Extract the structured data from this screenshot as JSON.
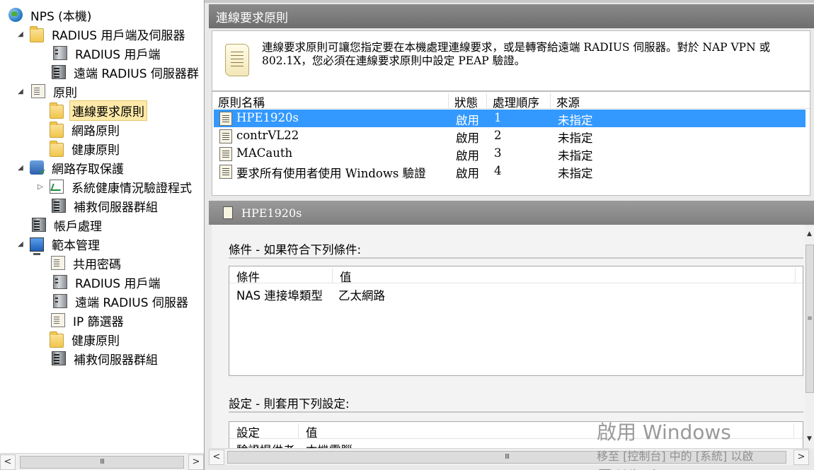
{
  "tree": {
    "items": [
      {
        "label": "NPS (本機)",
        "icon": "globe-icon",
        "level": 0,
        "expander": ""
      },
      {
        "label": "RADIUS 用戶端及伺服器",
        "icon": "folder-icon",
        "level": 1,
        "expander": "◢"
      },
      {
        "label": "RADIUS 用戶端",
        "icon": "server-icon",
        "level": 2,
        "expander": ""
      },
      {
        "label": "遠端 RADIUS 伺服器群",
        "icon": "server-group-icon",
        "level": 2,
        "expander": ""
      },
      {
        "label": "原則",
        "icon": "policy-doc-icon",
        "level": 1,
        "expander": "◢"
      },
      {
        "label": "連線要求原則",
        "icon": "folder-open-icon",
        "level": 2,
        "expander": "",
        "selected": true
      },
      {
        "label": "網路原則",
        "icon": "folder-icon",
        "level": 2,
        "expander": ""
      },
      {
        "label": "健康原則",
        "icon": "folder-icon",
        "level": 2,
        "expander": ""
      },
      {
        "label": "網路存取保護",
        "icon": "shield-icon",
        "level": 1,
        "expander": "◢"
      },
      {
        "label": "系統健康情況驗證程式",
        "icon": "chart-icon",
        "level": 2,
        "expander": "▷"
      },
      {
        "label": "補救伺服器群組",
        "icon": "server-group-icon",
        "level": 2,
        "expander": ""
      },
      {
        "label": "帳戶處理",
        "icon": "accounting-icon",
        "level": 1,
        "expander": ""
      },
      {
        "label": "範本管理",
        "icon": "monitor-icon",
        "level": 1,
        "expander": "◢"
      },
      {
        "label": "共用密碼",
        "icon": "doc-icon",
        "level": 2,
        "expander": ""
      },
      {
        "label": "RADIUS 用戶端",
        "icon": "server-icon",
        "level": 2,
        "expander": ""
      },
      {
        "label": "遠端 RADIUS 伺服器",
        "icon": "server-icon",
        "level": 2,
        "expander": ""
      },
      {
        "label": "IP 篩選器",
        "icon": "doc-icon",
        "level": 2,
        "expander": ""
      },
      {
        "label": "健康原則",
        "icon": "folder-icon",
        "level": 2,
        "expander": ""
      },
      {
        "label": "補救伺服器群組",
        "icon": "server-group-icon",
        "level": 2,
        "expander": ""
      }
    ],
    "scroll_left": "<",
    "scroll_right": ">",
    "scroll_grip": "III"
  },
  "main": {
    "title": "連線要求原則",
    "description": "連線要求原則可讓您指定要在本機處理連線要求，或是轉寄給遠端 RADIUS 伺服器。對於 NAP VPN 或 802.1X，您必須在連線要求原則中設定 PEAP 驗證。",
    "columns": [
      "原則名稱",
      "狀態",
      "處理順序",
      "來源"
    ],
    "rows": [
      {
        "name": "HPE1920s",
        "status": "啟用",
        "order": "1",
        "source": "未指定",
        "selected": true
      },
      {
        "name": "contrVL22",
        "status": "啟用",
        "order": "2",
        "source": "未指定"
      },
      {
        "name": "MACauth",
        "status": "啟用",
        "order": "3",
        "source": "未指定"
      },
      {
        "name": "要求所有使用者使用 Windows 驗證",
        "status": "啟用",
        "order": "4",
        "source": "未指定"
      }
    ]
  },
  "detail": {
    "title": "HPE1920s",
    "conditions_title": "條件 - 如果符合下列條件:",
    "conditions_columns": [
      "條件",
      "值"
    ],
    "conditions_rows": [
      {
        "name": "NAS 連接埠類型",
        "value": "乙太網路"
      }
    ],
    "settings_title": "設定 - 則套用下列設定:",
    "settings_columns": [
      "設定",
      "值"
    ],
    "settings_rows": [
      {
        "name": "驗證提供者",
        "value": "本機電腦"
      }
    ],
    "scroll_left": "<",
    "scroll_right": ">",
    "scroll_grip": "III",
    "vscroll_up": "▲",
    "vscroll_down": "▼",
    "vscroll_grip": "≡"
  },
  "watermark": {
    "line1": "啟用 Windows",
    "line2": "移至 [控制台] 中的 [系統] 以啟",
    "line3": "用 Windows。"
  },
  "colors": {
    "selection": "#3399ff",
    "header_bar": "#7a7a7a",
    "tree_selection": "#fde9a8"
  }
}
